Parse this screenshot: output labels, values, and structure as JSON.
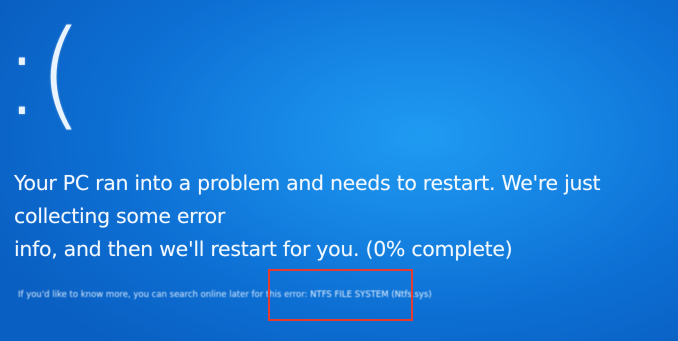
{
  "bsod": {
    "sad_face": ":(",
    "message_line1": "Your PC ran into a problem and needs to restart. We're just collecting some error",
    "message_line2": "info, and then we'll restart for you. (0% complete)",
    "info_prefix": "If you'd like to know more, you can search online later for this error:",
    "stop_code": "NTFS FILE SYSTEM (Ntfs.sys)",
    "background_color": "#1584e3",
    "highlight_color": "#e83b2f"
  }
}
